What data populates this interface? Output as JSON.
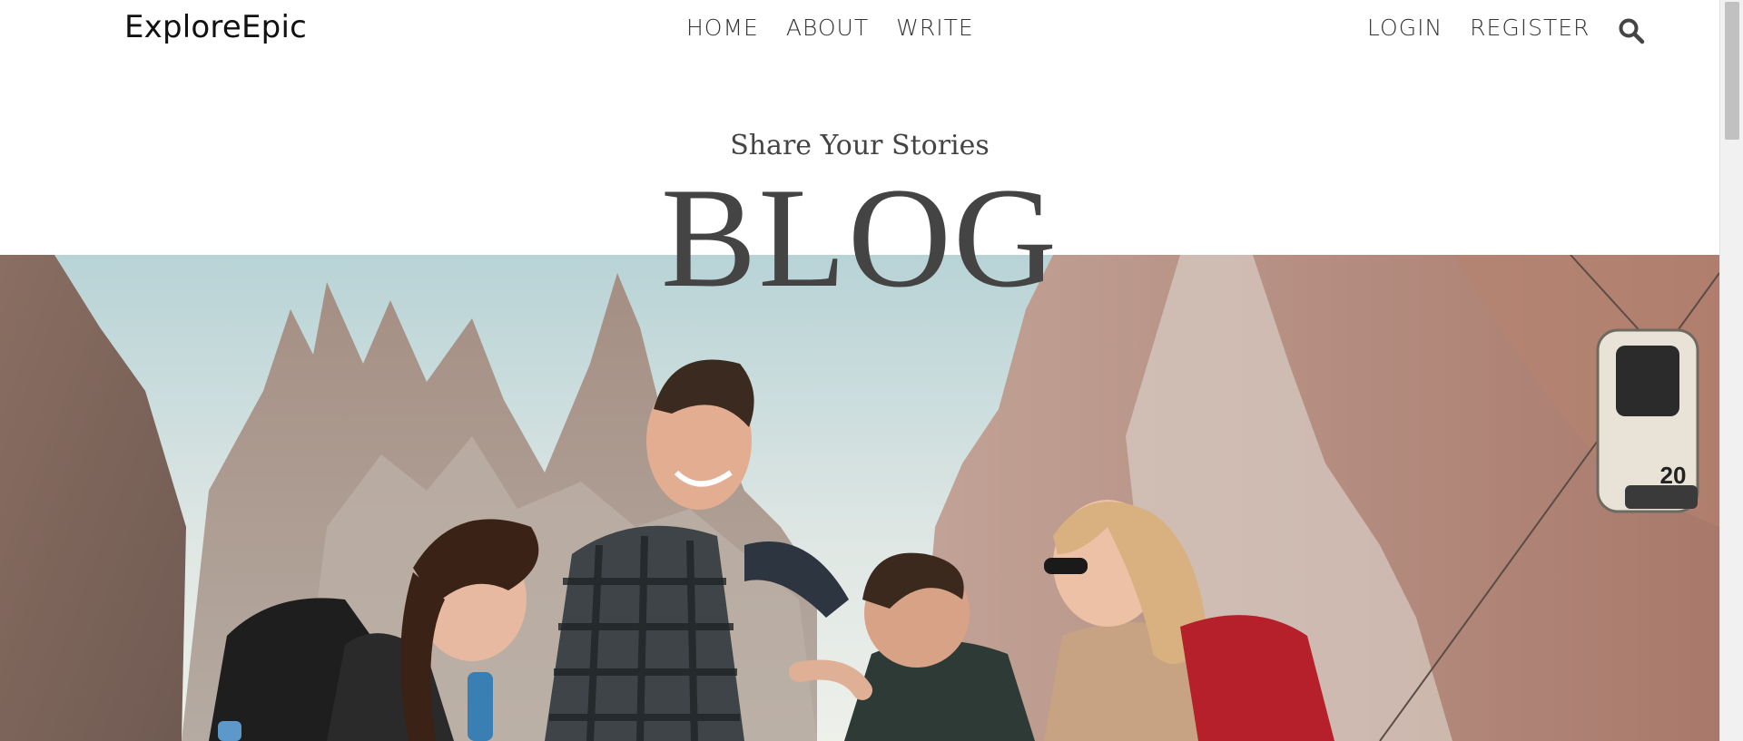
{
  "brand": {
    "logo": "ExploreEpic"
  },
  "nav": {
    "left_items": [
      "HOME",
      "ABOUT",
      "WRITE"
    ],
    "right_items": [
      "LOGIN",
      "REGISTER"
    ],
    "search_icon": "search-icon"
  },
  "hero": {
    "subtitle": "Share Your Stories",
    "title": "BLOG",
    "cable_car_number": "20"
  }
}
